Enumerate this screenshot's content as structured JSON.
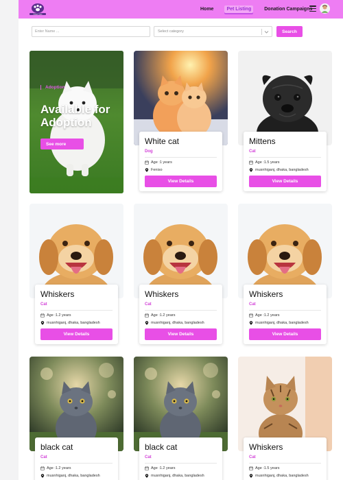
{
  "navbar": {
    "logo_text": "Adopt Care",
    "links": [
      {
        "label": "Home"
      },
      {
        "label": "Pet Listing"
      },
      {
        "label": "Donation Campaigns"
      }
    ]
  },
  "filters": {
    "name_placeholder": "Enter Name ...",
    "category_placeholder": "Select category",
    "search_label": "Search"
  },
  "hero": {
    "tag": "Adoption",
    "title": "Available for Adoption",
    "button_label": "See more"
  },
  "labels": {
    "age_prefix": "Age : ",
    "details_button": "View Details"
  },
  "colors": {
    "navbar": "#ee7df3",
    "accent": "#e84fe6",
    "category_text": "#d23fd8"
  },
  "pets": [
    {
      "name": "White cat",
      "category": "Dog",
      "age": "1 years",
      "location": "Feniso",
      "image": "kittens"
    },
    {
      "name": "Mittens",
      "category": "Cat",
      "age": "1.5 years",
      "location": "musnhiganj, dhaka, bangladesh",
      "image": "black-pug"
    },
    {
      "name": "Whiskers",
      "category": "Cat",
      "age": "1.2 years",
      "location": "musnhiganj, dhaka, bangladesh",
      "image": "golden-dog"
    },
    {
      "name": "Whiskers",
      "category": "Cat",
      "age": "1.2 years",
      "location": "musnhiganj, dhaka, bangladesh",
      "image": "golden-dog"
    },
    {
      "name": "Whiskers",
      "category": "Cat",
      "age": "1.2 years",
      "location": "musnhiganj, dhaka, bangladesh",
      "image": "golden-dog"
    },
    {
      "name": "black cat",
      "category": "Cat",
      "age": "1.2 years",
      "location": "musnhiganj, dhaka, bangladesh",
      "image": "gray-cat"
    },
    {
      "name": "black cat",
      "category": "Cat",
      "age": "1.2 years",
      "location": "musnhiganj, dhaka, bangladesh",
      "image": "gray-cat"
    },
    {
      "name": "Whiskers",
      "category": "Cat",
      "age": "1.5 years",
      "location": "musnhiganj, dhaka, bangladesh",
      "image": "tabby-cat"
    }
  ]
}
